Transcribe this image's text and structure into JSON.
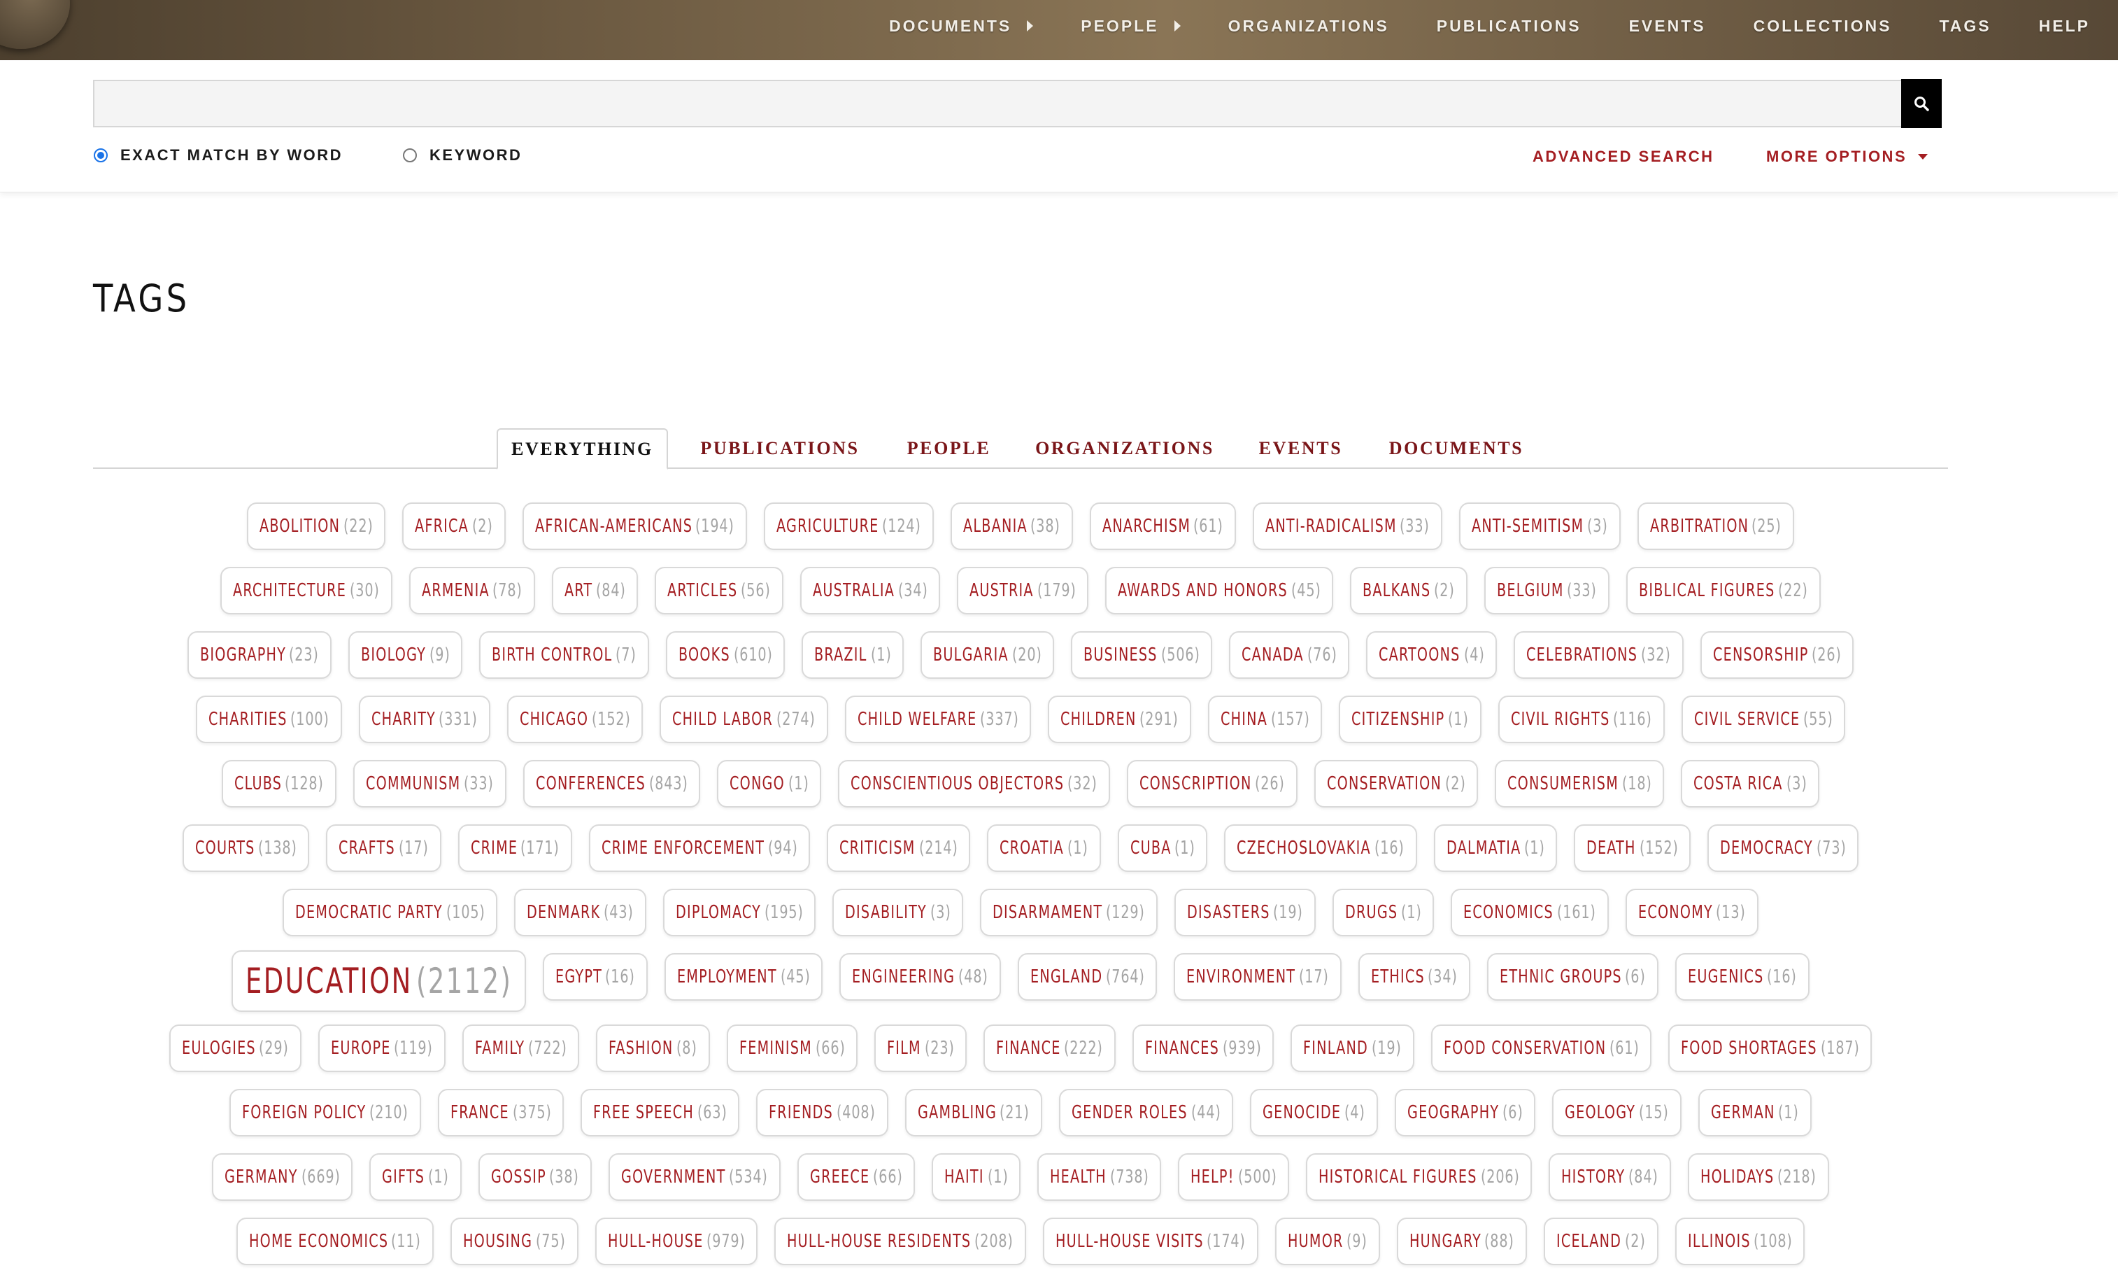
{
  "nav": {
    "items": [
      {
        "label": "DOCUMENTS",
        "submenu": true
      },
      {
        "label": "PEOPLE",
        "submenu": true
      },
      {
        "label": "ORGANIZATIONS",
        "submenu": false
      },
      {
        "label": "PUBLICATIONS",
        "submenu": false
      },
      {
        "label": "EVENTS",
        "submenu": false
      },
      {
        "label": "COLLECTIONS",
        "submenu": false
      },
      {
        "label": "TAGS",
        "submenu": false
      },
      {
        "label": "HELP",
        "submenu": false
      }
    ]
  },
  "search": {
    "value": "",
    "placeholder": "",
    "options": {
      "exact": "EXACT MATCH BY WORD",
      "keyword": "KEYWORD"
    },
    "selected": "exact",
    "advanced": "ADVANCED SEARCH",
    "more": "MORE OPTIONS"
  },
  "page": {
    "title": "TAGS"
  },
  "tabs": [
    "EVERYTHING",
    "PUBLICATIONS",
    "PEOPLE",
    "ORGANIZATIONS",
    "EVENTS",
    "DOCUMENTS"
  ],
  "active_tab": "EVERYTHING",
  "colors": {
    "accent": "#a41e22",
    "tab_text": "#7a1518",
    "count": "#a5a5a5",
    "radio": "#1a73e8"
  },
  "tag_rows": [
    [
      {
        "name": "ABOLITION",
        "count": "(22)"
      },
      {
        "name": "AFRICA",
        "count": "(2)"
      },
      {
        "name": "AFRICAN-AMERICANS",
        "count": "(194)"
      },
      {
        "name": "AGRICULTURE",
        "count": "(124)"
      },
      {
        "name": "ALBANIA",
        "count": "(38)"
      },
      {
        "name": "ANARCHISM",
        "count": "(61)"
      },
      {
        "name": "ANTI-RADICALISM",
        "count": "(33)"
      },
      {
        "name": "ANTI-SEMITISM",
        "count": "(3)"
      },
      {
        "name": "ARBITRATION",
        "count": "(25)"
      }
    ],
    [
      {
        "name": "ARCHITECTURE",
        "count": "(30)"
      },
      {
        "name": "ARMENIA",
        "count": "(78)"
      },
      {
        "name": "ART",
        "count": "(84)"
      },
      {
        "name": "ARTICLES",
        "count": "(56)"
      },
      {
        "name": "AUSTRALIA",
        "count": "(34)"
      },
      {
        "name": "AUSTRIA",
        "count": "(179)"
      },
      {
        "name": "AWARDS AND HONORS",
        "count": "(45)"
      },
      {
        "name": "BALKANS",
        "count": "(2)"
      },
      {
        "name": "BELGIUM",
        "count": "(33)"
      },
      {
        "name": "BIBLICAL FIGURES",
        "count": "(22)"
      }
    ],
    [
      {
        "name": "BIOGRAPHY",
        "count": "(23)"
      },
      {
        "name": "BIOLOGY",
        "count": "(9)"
      },
      {
        "name": "BIRTH CONTROL",
        "count": "(7)"
      },
      {
        "name": "BOOKS",
        "count": "(610)"
      },
      {
        "name": "BRAZIL",
        "count": "(1)"
      },
      {
        "name": "BULGARIA",
        "count": "(20)"
      },
      {
        "name": "BUSINESS",
        "count": "(506)"
      },
      {
        "name": "CANADA",
        "count": "(76)"
      },
      {
        "name": "CARTOONS",
        "count": "(4)"
      },
      {
        "name": "CELEBRATIONS",
        "count": "(32)"
      },
      {
        "name": "CENSORSHIP",
        "count": "(26)"
      }
    ],
    [
      {
        "name": "CHARITIES",
        "count": "(100)"
      },
      {
        "name": "CHARITY",
        "count": "(331)"
      },
      {
        "name": "CHICAGO",
        "count": "(152)"
      },
      {
        "name": "CHILD LABOR",
        "count": "(274)"
      },
      {
        "name": "CHILD WELFARE",
        "count": "(337)"
      },
      {
        "name": "CHILDREN",
        "count": "(291)"
      },
      {
        "name": "CHINA",
        "count": "(157)"
      },
      {
        "name": "CITIZENSHIP",
        "count": "(1)"
      },
      {
        "name": "CIVIL RIGHTS",
        "count": "(116)"
      },
      {
        "name": "CIVIL SERVICE",
        "count": "(55)"
      }
    ],
    [
      {
        "name": "CLUBS",
        "count": "(128)"
      },
      {
        "name": "COMMUNISM",
        "count": "(33)"
      },
      {
        "name": "CONFERENCES",
        "count": "(843)"
      },
      {
        "name": "CONGO",
        "count": "(1)"
      },
      {
        "name": "CONSCIENTIOUS OBJECTORS",
        "count": "(32)"
      },
      {
        "name": "CONSCRIPTION",
        "count": "(26)"
      },
      {
        "name": "CONSERVATION",
        "count": "(2)"
      },
      {
        "name": "CONSUMERISM",
        "count": "(18)"
      },
      {
        "name": "COSTA RICA",
        "count": "(3)"
      }
    ],
    [
      {
        "name": "COURTS",
        "count": "(138)"
      },
      {
        "name": "CRAFTS",
        "count": "(17)"
      },
      {
        "name": "CRIME",
        "count": "(171)"
      },
      {
        "name": "CRIME ENFORCEMENT",
        "count": "(94)"
      },
      {
        "name": "CRITICISM",
        "count": "(214)"
      },
      {
        "name": "CROATIA",
        "count": "(1)"
      },
      {
        "name": "CUBA",
        "count": "(1)"
      },
      {
        "name": "CZECHOSLOVAKIA",
        "count": "(16)"
      },
      {
        "name": "DALMATIA",
        "count": "(1)"
      },
      {
        "name": "DEATH",
        "count": "(152)"
      },
      {
        "name": "DEMOCRACY",
        "count": "(73)"
      }
    ],
    [
      {
        "name": "DEMOCRATIC PARTY",
        "count": "(105)"
      },
      {
        "name": "DENMARK",
        "count": "(43)"
      },
      {
        "name": "DIPLOMACY",
        "count": "(195)"
      },
      {
        "name": "DISABILITY",
        "count": "(3)"
      },
      {
        "name": "DISARMAMENT",
        "count": "(129)"
      },
      {
        "name": "DISASTERS",
        "count": "(19)"
      },
      {
        "name": "DRUGS",
        "count": "(1)"
      },
      {
        "name": "ECONOMICS",
        "count": "(161)"
      },
      {
        "name": "ECONOMY",
        "count": "(13)"
      }
    ],
    [
      {
        "name": "EDUCATION",
        "count": "(2112)",
        "big": true
      },
      {
        "name": "EGYPT",
        "count": "(16)"
      },
      {
        "name": "EMPLOYMENT",
        "count": "(45)"
      },
      {
        "name": "ENGINEERING",
        "count": "(48)"
      },
      {
        "name": "ENGLAND",
        "count": "(764)"
      },
      {
        "name": "ENVIRONMENT",
        "count": "(17)"
      },
      {
        "name": "ETHICS",
        "count": "(34)"
      },
      {
        "name": "ETHNIC GROUPS",
        "count": "(6)"
      },
      {
        "name": "EUGENICS",
        "count": "(16)"
      }
    ],
    [
      {
        "name": "EULOGIES",
        "count": "(29)"
      },
      {
        "name": "EUROPE",
        "count": "(119)"
      },
      {
        "name": "FAMILY",
        "count": "(722)"
      },
      {
        "name": "FASHION",
        "count": "(8)"
      },
      {
        "name": "FEMINISM",
        "count": "(66)"
      },
      {
        "name": "FILM",
        "count": "(23)"
      },
      {
        "name": "FINANCE",
        "count": "(222)"
      },
      {
        "name": "FINANCES",
        "count": "(939)"
      },
      {
        "name": "FINLAND",
        "count": "(19)"
      },
      {
        "name": "FOOD CONSERVATION",
        "count": "(61)"
      },
      {
        "name": "FOOD SHORTAGES",
        "count": "(187)"
      }
    ],
    [
      {
        "name": "FOREIGN POLICY",
        "count": "(210)"
      },
      {
        "name": "FRANCE",
        "count": "(375)"
      },
      {
        "name": "FREE SPEECH",
        "count": "(63)"
      },
      {
        "name": "FRIENDS",
        "count": "(408)"
      },
      {
        "name": "GAMBLING",
        "count": "(21)"
      },
      {
        "name": "GENDER ROLES",
        "count": "(44)"
      },
      {
        "name": "GENOCIDE",
        "count": "(4)"
      },
      {
        "name": "GEOGRAPHY",
        "count": "(6)"
      },
      {
        "name": "GEOLOGY",
        "count": "(15)"
      },
      {
        "name": "GERMAN",
        "count": "(1)"
      }
    ],
    [
      {
        "name": "GERMANY",
        "count": "(669)"
      },
      {
        "name": "GIFTS",
        "count": "(1)"
      },
      {
        "name": "GOSSIP",
        "count": "(38)"
      },
      {
        "name": "GOVERNMENT",
        "count": "(534)"
      },
      {
        "name": "GREECE",
        "count": "(66)"
      },
      {
        "name": "HAITI",
        "count": "(1)"
      },
      {
        "name": "HEALTH",
        "count": "(738)"
      },
      {
        "name": "HELP!",
        "count": "(500)"
      },
      {
        "name": "HISTORICAL FIGURES",
        "count": "(206)"
      },
      {
        "name": "HISTORY",
        "count": "(84)"
      },
      {
        "name": "HOLIDAYS",
        "count": "(218)"
      }
    ],
    [
      {
        "name": "HOME ECONOMICS",
        "count": "(11)"
      },
      {
        "name": "HOUSING",
        "count": "(75)"
      },
      {
        "name": "HULL-HOUSE",
        "count": "(979)"
      },
      {
        "name": "HULL-HOUSE RESIDENTS",
        "count": "(208)"
      },
      {
        "name": "HULL-HOUSE VISITS",
        "count": "(174)"
      },
      {
        "name": "HUMOR",
        "count": "(9)"
      },
      {
        "name": "HUNGARY",
        "count": "(88)"
      },
      {
        "name": "ICELAND",
        "count": "(2)"
      },
      {
        "name": "ILLINOIS",
        "count": "(108)"
      }
    ]
  ]
}
